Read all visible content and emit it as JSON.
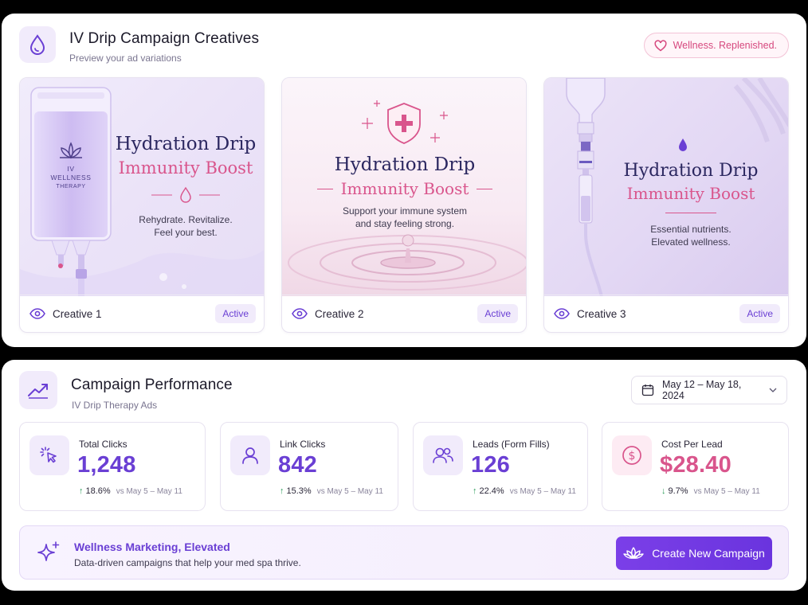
{
  "creatives_panel": {
    "title": "IV Drip Campaign Creatives",
    "subtitle": "Preview your ad variations",
    "tag": "Wellness. Replenished."
  },
  "creatives": [
    {
      "label": "Creative 1",
      "status": "Active",
      "bag_brand": "IV WELLNESS",
      "bag_sub": "THERAPY",
      "headline": "Hydration Drip",
      "subhead": "Immunity Boost",
      "copy_line1": "Rehydrate. Revitalize.",
      "copy_line2": "Feel your best."
    },
    {
      "label": "Creative 2",
      "status": "Active",
      "headline": "Hydration Drip",
      "subhead": "Immunity Boost",
      "copy_line1": "Support your immune system",
      "copy_line2": "and stay feeling strong."
    },
    {
      "label": "Creative 3",
      "status": "Active",
      "headline": "Hydration Drip",
      "subhead": "Immunity Boost",
      "copy_line1": "Essential nutrients.",
      "copy_line2": "Elevated wellness."
    }
  ],
  "performance": {
    "title": "Campaign Performance",
    "subtitle": "IV Drip Therapy Ads",
    "date_range": "May 12 – May 18, 2024"
  },
  "stats": [
    {
      "label": "Total Clicks",
      "value": "1,248",
      "change": "18.6%",
      "direction": "up",
      "compare": "vs May 5 – May 11",
      "icon": "cursor-click-icon"
    },
    {
      "label": "Link Clicks",
      "value": "842",
      "change": "15.3%",
      "direction": "up",
      "compare": "vs May 5 – May 11",
      "icon": "user-icon"
    },
    {
      "label": "Leads (Form Fills)",
      "value": "126",
      "change": "22.4%",
      "direction": "up",
      "compare": "vs May 5 – May 11",
      "icon": "users-icon"
    },
    {
      "label": "Cost Per Lead",
      "value": "$28.40",
      "change": "9.7%",
      "direction": "down",
      "compare": "vs May 5 – May 11",
      "icon": "dollar-coin-icon"
    }
  ],
  "banner": {
    "title": "Wellness Marketing, Elevated",
    "subtitle": "Data-driven campaigns that help your med spa thrive.",
    "cta_label": "Create New Campaign"
  },
  "colors": {
    "accent": "#6a3fd4",
    "pink": "#d9558c",
    "up": "#2e9e5b",
    "down": "#2e9e5b",
    "navy": "#2b2760"
  }
}
